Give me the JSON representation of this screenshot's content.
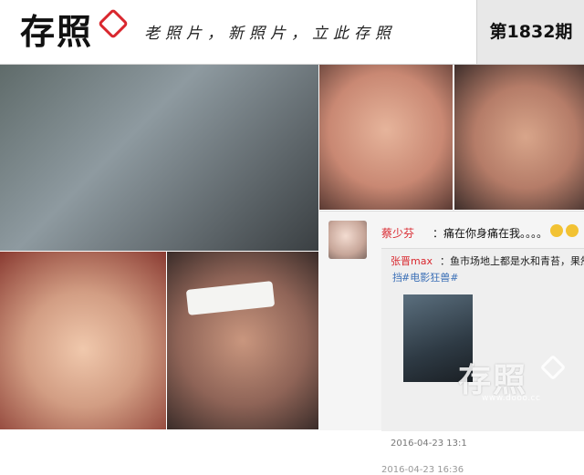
{
  "header": {
    "logo_text": "存照",
    "slogan": "老照片，新照片，立此存照",
    "issue": "第1832期"
  },
  "weibo": {
    "user": "蔡少芬",
    "text": "：痛在你身痛在我。。。。",
    "repost": {
      "user": "张晋max",
      "text": "：鱼市场地上都是水和青苔，果然很",
      "tag_hash": "挡",
      "tag": "#电影狂兽#",
      "date": "2016-04-23 13:1",
      "date2": "2016-04-23 16:36"
    }
  },
  "watermark": {
    "text": "存照",
    "url": "www.dooo.cc"
  },
  "colors": {
    "accent": "#d9272e",
    "link": "#3b6fb6"
  }
}
